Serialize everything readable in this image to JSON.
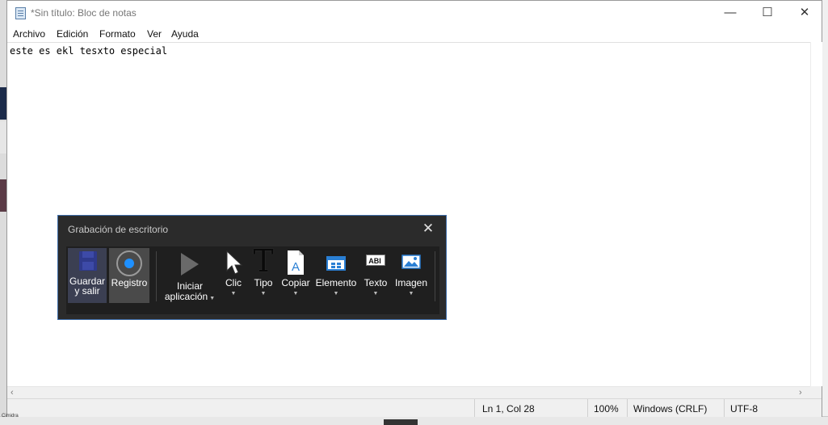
{
  "notepad": {
    "title": "*Sin título: Bloc de notas",
    "window_buttons": {
      "minimize": "—",
      "maximize": "☐",
      "close": "✕"
    },
    "menu": [
      "Archivo",
      "Edición",
      "Formato",
      "Ver",
      "Ayuda"
    ],
    "content": "este es ekl tesxto especial",
    "scroll": {
      "left": "‹",
      "right": "›"
    },
    "status": {
      "position": "Ln 1, Col 28",
      "zoom": "100%",
      "line_ending": "Windows (CRLF)",
      "encoding": "UTF-8"
    }
  },
  "recorder": {
    "title": "Grabación de escritorio",
    "close": "✕",
    "tools": {
      "save": "Guardar y salir",
      "record": "Registro",
      "launch": "Iniciar aplicación",
      "click": "Clic",
      "type": "Tipo",
      "copy": "Copiar",
      "element": "Elemento",
      "text": "Texto",
      "image": "Imagen"
    },
    "type_glyph": "T",
    "copy_glyph": "A",
    "text_glyph": "ABI",
    "caret": "▼"
  },
  "background": {
    "bottom_left": "Cimidra"
  },
  "colors": {
    "accent_border": "#3f6eaa",
    "record_blue": "#1e90ff",
    "panel_bg": "#2b2b2b"
  }
}
